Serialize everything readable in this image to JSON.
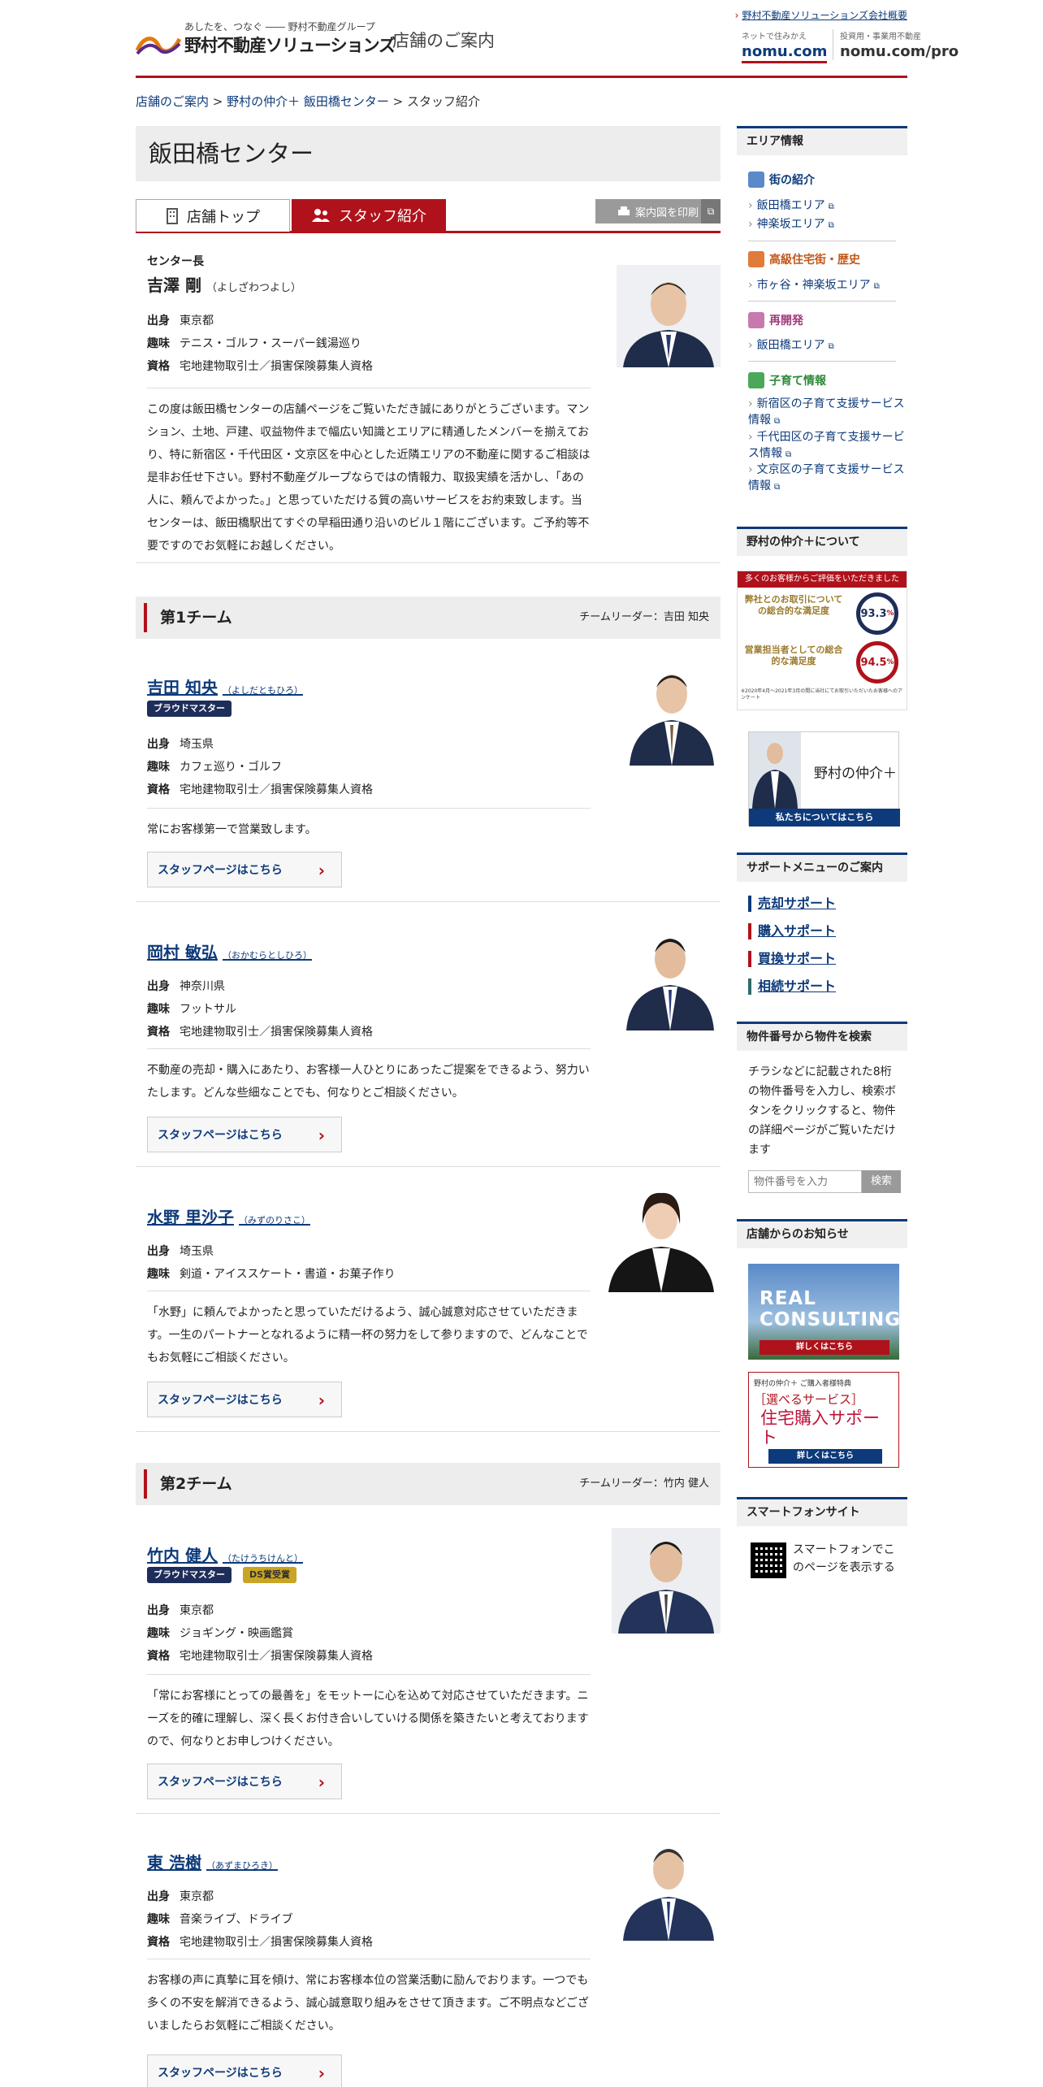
{
  "header": {
    "tagline": "あしたを、つなぐ ―― 野村不動産グループ",
    "logo": "野村不動産ソリューションズ",
    "site_name": "店舗のご案内",
    "corp_link": "野村不動産ソリューションズ会社概要",
    "nomu1_small": "ネットで住みかえ",
    "nomu1_main": "nomu.com",
    "nomu2_small": "投資用・事業用不動産",
    "nomu2_main": "nomu.com/pro"
  },
  "breadcrumb": {
    "items": [
      "店舗のご案内",
      "野村の仲介＋ 飯田橋センター"
    ],
    "current": "スタッフ紹介",
    "sep": " > "
  },
  "page_title": "飯田橋センター",
  "tabs": {
    "top": "店舗トップ",
    "staff": "スタッフ紹介",
    "print": "案内図を印刷"
  },
  "center_head": {
    "role": "センター長",
    "name": "吉澤 剛",
    "kana": "（よしざわつよし）",
    "birth_label": "出身",
    "birth": "東京都",
    "hobby_label": "趣味",
    "hobby": "テニス・ゴルフ・スーパー銭湯巡り",
    "qual_label": "資格",
    "qual": "宅地建物取引士／損害保険募集人資格",
    "message": "この度は飯田橋センターの店舗ページをご覧いただき誠にありがとうございます。マンション、土地、戸建、収益物件まで幅広い知識とエリアに精通したメンバーを揃えており、特に新宿区・千代田区・文京区を中心とした近隣エリアの不動産に関するご相談は是非お任せ下さい。野村不動産グループならではの情報力、取扱実績を活かし、「あの人に、頼んでよかった。」と思っていただける質の高いサービスをお約束致します。当センターは、飯田橋駅出てすぐの早稲田通り沿いのビル１階にございます。ご予約等不要ですのでお気軽にお越しください。"
  },
  "teams": [
    {
      "title": "第1チーム",
      "leader": "チームリーダー：吉田 知央"
    },
    {
      "title": "第2チーム",
      "leader": "チームリーダー：竹内 健人"
    }
  ],
  "labels": {
    "birth": "出身",
    "hobby": "趣味",
    "qual": "資格",
    "staff_btn": "スタッフページはこちら"
  },
  "staff": [
    {
      "name": "吉田 知央",
      "kana": "（よしだともひろ）",
      "badges": [
        "ブラウドマスター"
      ],
      "birth": "埼玉県",
      "hobby": "カフェ巡り・ゴルフ",
      "qual": "宅地建物取引士／損害保険募集人資格",
      "message": "常にお客様第一で営業致します。"
    },
    {
      "name": "岡村 敏弘",
      "kana": "（おかむらとしひろ）",
      "birth": "神奈川県",
      "hobby": "フットサル",
      "qual": "宅地建物取引士／損害保険募集人資格",
      "message": "不動産の売却・購入にあたり、お客様一人ひとりにあったご提案をできるよう、努力いたします。どんな些細なことでも、何なりとご相談ください。"
    },
    {
      "name": "水野 里沙子",
      "kana": "（みずのりさこ）",
      "birth": "埼玉県",
      "hobby": "剣道・アイススケート・書道・お菓子作り",
      "message": "「水野」に頼んでよかったと思っていただけるよう、誠心誠意対応させていただきます。一生のパートナーとなれるように精一杯の努力をして参りますので、どんなことでもお気軽にご相談ください。"
    },
    {
      "name": "竹内 健人",
      "kana": "（たけうちけんと）",
      "badges": [
        "ブラウドマスター",
        "DS賞受賞"
      ],
      "birth": "東京都",
      "hobby": "ジョギング・映画鑑賞",
      "qual": "宅地建物取引士／損害保険募集人資格",
      "message": "「常にお客様にとっての最善を」をモットーに心を込めて対応させていただきます。ニーズを的確に理解し、深く長くお付き合いしていける関係を築きたいと考えておりますので、何なりとお申しつけください。"
    },
    {
      "name": "東 浩樹",
      "kana": "（あずまひろき）",
      "birth": "東京都",
      "hobby": "音楽ライブ、ドライブ",
      "qual": "宅地建物取引士／損害保険募集人資格",
      "message": "お客様の声に真摯に耳を傾け、常にお客様本位の営業活動に励んでおります。一つでも多くの不安を解消できるよう、誠心誠意取り組みをさせて頂きます。ご不明点などございましたらお気軽にご相談ください。"
    }
  ],
  "sidebar": {
    "area_title": "エリア情報",
    "cat_town": "街の紹介",
    "town_links": [
      "飯田橋エリア",
      "神楽坂エリア"
    ],
    "cat_luxury": "高級住宅街・歴史",
    "luxury_links": [
      "市ヶ谷・神楽坂エリア"
    ],
    "cat_redev": "再開発",
    "redev_links": [
      "飯田橋エリア"
    ],
    "cat_child": "子育て情報",
    "child_links": [
      "新宿区の子育て支援サービス情報",
      "千代田区の子育て支援サービス情報",
      "文京区の子育て支援サービス情報"
    ],
    "about_title": "野村の仲介＋について",
    "survey_head": "多くのお客様からご評価をいただきました",
    "survey1_label": "弊社とのお取引についての総合的な満足度",
    "survey1_value": "93.3",
    "survey2_label": "営業担当者としての総合的な満足度",
    "survey2_value": "94.5",
    "survey_pct": "%",
    "survey_note": "※2020年4月～2021年3月の間に当社にてお取引いただいたお客様へのアンケート",
    "brand_banner": "野村の仲介＋",
    "brand_banner_link": "私たちについてはこちら",
    "support_title": "サポートメニューのご案内",
    "support_links": [
      "売却サポート",
      "購入サポート",
      "買換サポート",
      "相続サポート"
    ],
    "search_title": "物件番号から物件を検索",
    "search_desc": "チラシなどに記載された8桁の物件番号を入力し、検索ボタンをクリックすると、物件の詳細ページがご覧いただけます",
    "search_placeholder": "物件番号を入力",
    "search_btn": "検索",
    "news_title": "店舗からのお知らせ",
    "banner1_title": "REAL CONSULTING",
    "banner1_link": "詳しくはこちら",
    "banner2_top": "野村の仲介＋ ご購入者様特典",
    "banner2_mid": "［選べるサービス］",
    "banner2_title": "住宅購入サポート",
    "banner2_link": "詳しくはこちら",
    "sp_title": "スマートフォンサイト",
    "sp_desc": "スマートフォンでこのページを表示する"
  },
  "colors": {
    "brand_red": "#b0121b",
    "navy": "#0d3a7a"
  }
}
